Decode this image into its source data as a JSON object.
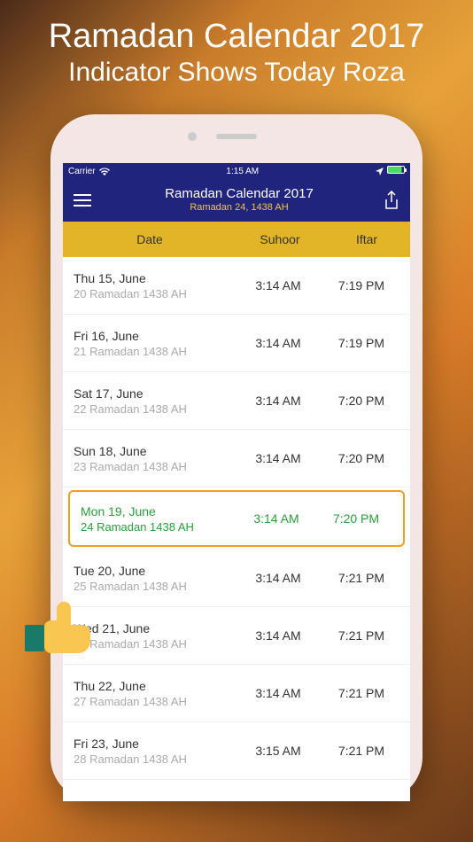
{
  "promo": {
    "title": "Ramadan Calendar 2017",
    "subtitle": "Indicator Shows Today Roza"
  },
  "status_bar": {
    "carrier": "Carrier",
    "time": "1:15 AM"
  },
  "header": {
    "title": "Ramadan Calendar 2017",
    "subtitle": "Ramadan 24, 1438 AH"
  },
  "columns": {
    "date": "Date",
    "suhoor": "Suhoor",
    "iftar": "Iftar"
  },
  "rows": [
    {
      "gregorian": "Thu 15, June",
      "hijri": "20 Ramadan 1438 AH",
      "suhoor": "3:14 AM",
      "iftar": "7:19 PM",
      "highlighted": false
    },
    {
      "gregorian": "Fri 16, June",
      "hijri": "21 Ramadan 1438 AH",
      "suhoor": "3:14 AM",
      "iftar": "7:19 PM",
      "highlighted": false
    },
    {
      "gregorian": "Sat 17, June",
      "hijri": "22 Ramadan 1438 AH",
      "suhoor": "3:14 AM",
      "iftar": "7:20 PM",
      "highlighted": false
    },
    {
      "gregorian": "Sun 18, June",
      "hijri": "23 Ramadan 1438 AH",
      "suhoor": "3:14 AM",
      "iftar": "7:20 PM",
      "highlighted": false
    },
    {
      "gregorian": "Mon 19, June",
      "hijri": "24 Ramadan 1438 AH",
      "suhoor": "3:14 AM",
      "iftar": "7:20 PM",
      "highlighted": true
    },
    {
      "gregorian": "Tue 20, June",
      "hijri": "25 Ramadan 1438 AH",
      "suhoor": "3:14 AM",
      "iftar": "7:21 PM",
      "highlighted": false
    },
    {
      "gregorian": "Wed 21, June",
      "hijri": "26 Ramadan 1438 AH",
      "suhoor": "3:14 AM",
      "iftar": "7:21 PM",
      "highlighted": false
    },
    {
      "gregorian": "Thu 22, June",
      "hijri": "27 Ramadan 1438 AH",
      "suhoor": "3:14 AM",
      "iftar": "7:21 PM",
      "highlighted": false
    },
    {
      "gregorian": "Fri 23, June",
      "hijri": "28 Ramadan 1438 AH",
      "suhoor": "3:15 AM",
      "iftar": "7:21 PM",
      "highlighted": false
    }
  ]
}
